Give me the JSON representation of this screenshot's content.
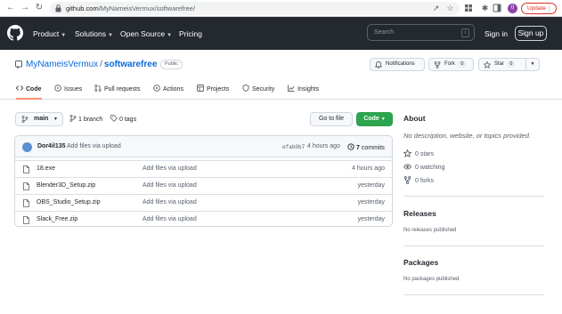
{
  "browser": {
    "url_host": "github.com",
    "url_path": "/MyNameisVermux/softwarefree/",
    "profile_initial": "0",
    "update_label": "Update"
  },
  "header": {
    "nav": [
      {
        "label": "Product",
        "has_caret": true
      },
      {
        "label": "Solutions",
        "has_caret": true
      },
      {
        "label": "Open Source",
        "has_caret": true
      },
      {
        "label": "Pricing",
        "has_caret": false
      }
    ],
    "search_placeholder": "Search",
    "search_shortcut": "/",
    "signin_label": "Sign in",
    "signup_label": "Sign up"
  },
  "repo": {
    "owner": "MyNameisVermux",
    "separator": "/",
    "name": "softwarefree",
    "visibility": "Public",
    "notifications_label": "Notifications",
    "fork_label": "Fork",
    "fork_count": "0",
    "star_label": "Star",
    "star_count": "0"
  },
  "tabs": [
    {
      "label": "Code",
      "icon": "code-icon",
      "active": true
    },
    {
      "label": "Issues",
      "icon": "issue-icon",
      "active": false
    },
    {
      "label": "Pull requests",
      "icon": "pull-request-icon",
      "active": false
    },
    {
      "label": "Actions",
      "icon": "play-icon",
      "active": false
    },
    {
      "label": "Projects",
      "icon": "table-icon",
      "active": false
    },
    {
      "label": "Security",
      "icon": "shield-icon",
      "active": false
    },
    {
      "label": "Insights",
      "icon": "graph-icon",
      "active": false
    }
  ],
  "toolbar": {
    "branch": "main",
    "branches": "1 branch",
    "tags": "0 tags",
    "goto_file_label": "Go to file",
    "code_label": "Code"
  },
  "commit": {
    "author": "Dor4il135",
    "message": "Add files via upload",
    "sha": "efab0b7",
    "time": "4 hours ago",
    "count": "7",
    "count_suffix": "commits"
  },
  "files": [
    {
      "name": "18.exe",
      "message": "Add files via upload",
      "time": "4 hours ago"
    },
    {
      "name": "Blender3D_Setup.zip",
      "message": "Add files via upload",
      "time": "yesterday"
    },
    {
      "name": "OBS_Studio_Setup.zip",
      "message": "Add files via upload",
      "time": "yesterday"
    },
    {
      "name": "Slack_Free.zip",
      "message": "Add files via upload",
      "time": "yesterday"
    }
  ],
  "sidebar": {
    "about_title": "About",
    "about_desc": "No description, website, or topics provided.",
    "stars": "0 stars",
    "watching": "0 watching",
    "forks": "0 forks",
    "releases_title": "Releases",
    "releases_note": "No releases published",
    "packages_title": "Packages",
    "packages_note": "No packages published"
  },
  "colors": {
    "header_bg": "#24292f",
    "link": "#0969da",
    "primary_button": "#2da44e",
    "active_tab_underline": "#fd8c73"
  }
}
